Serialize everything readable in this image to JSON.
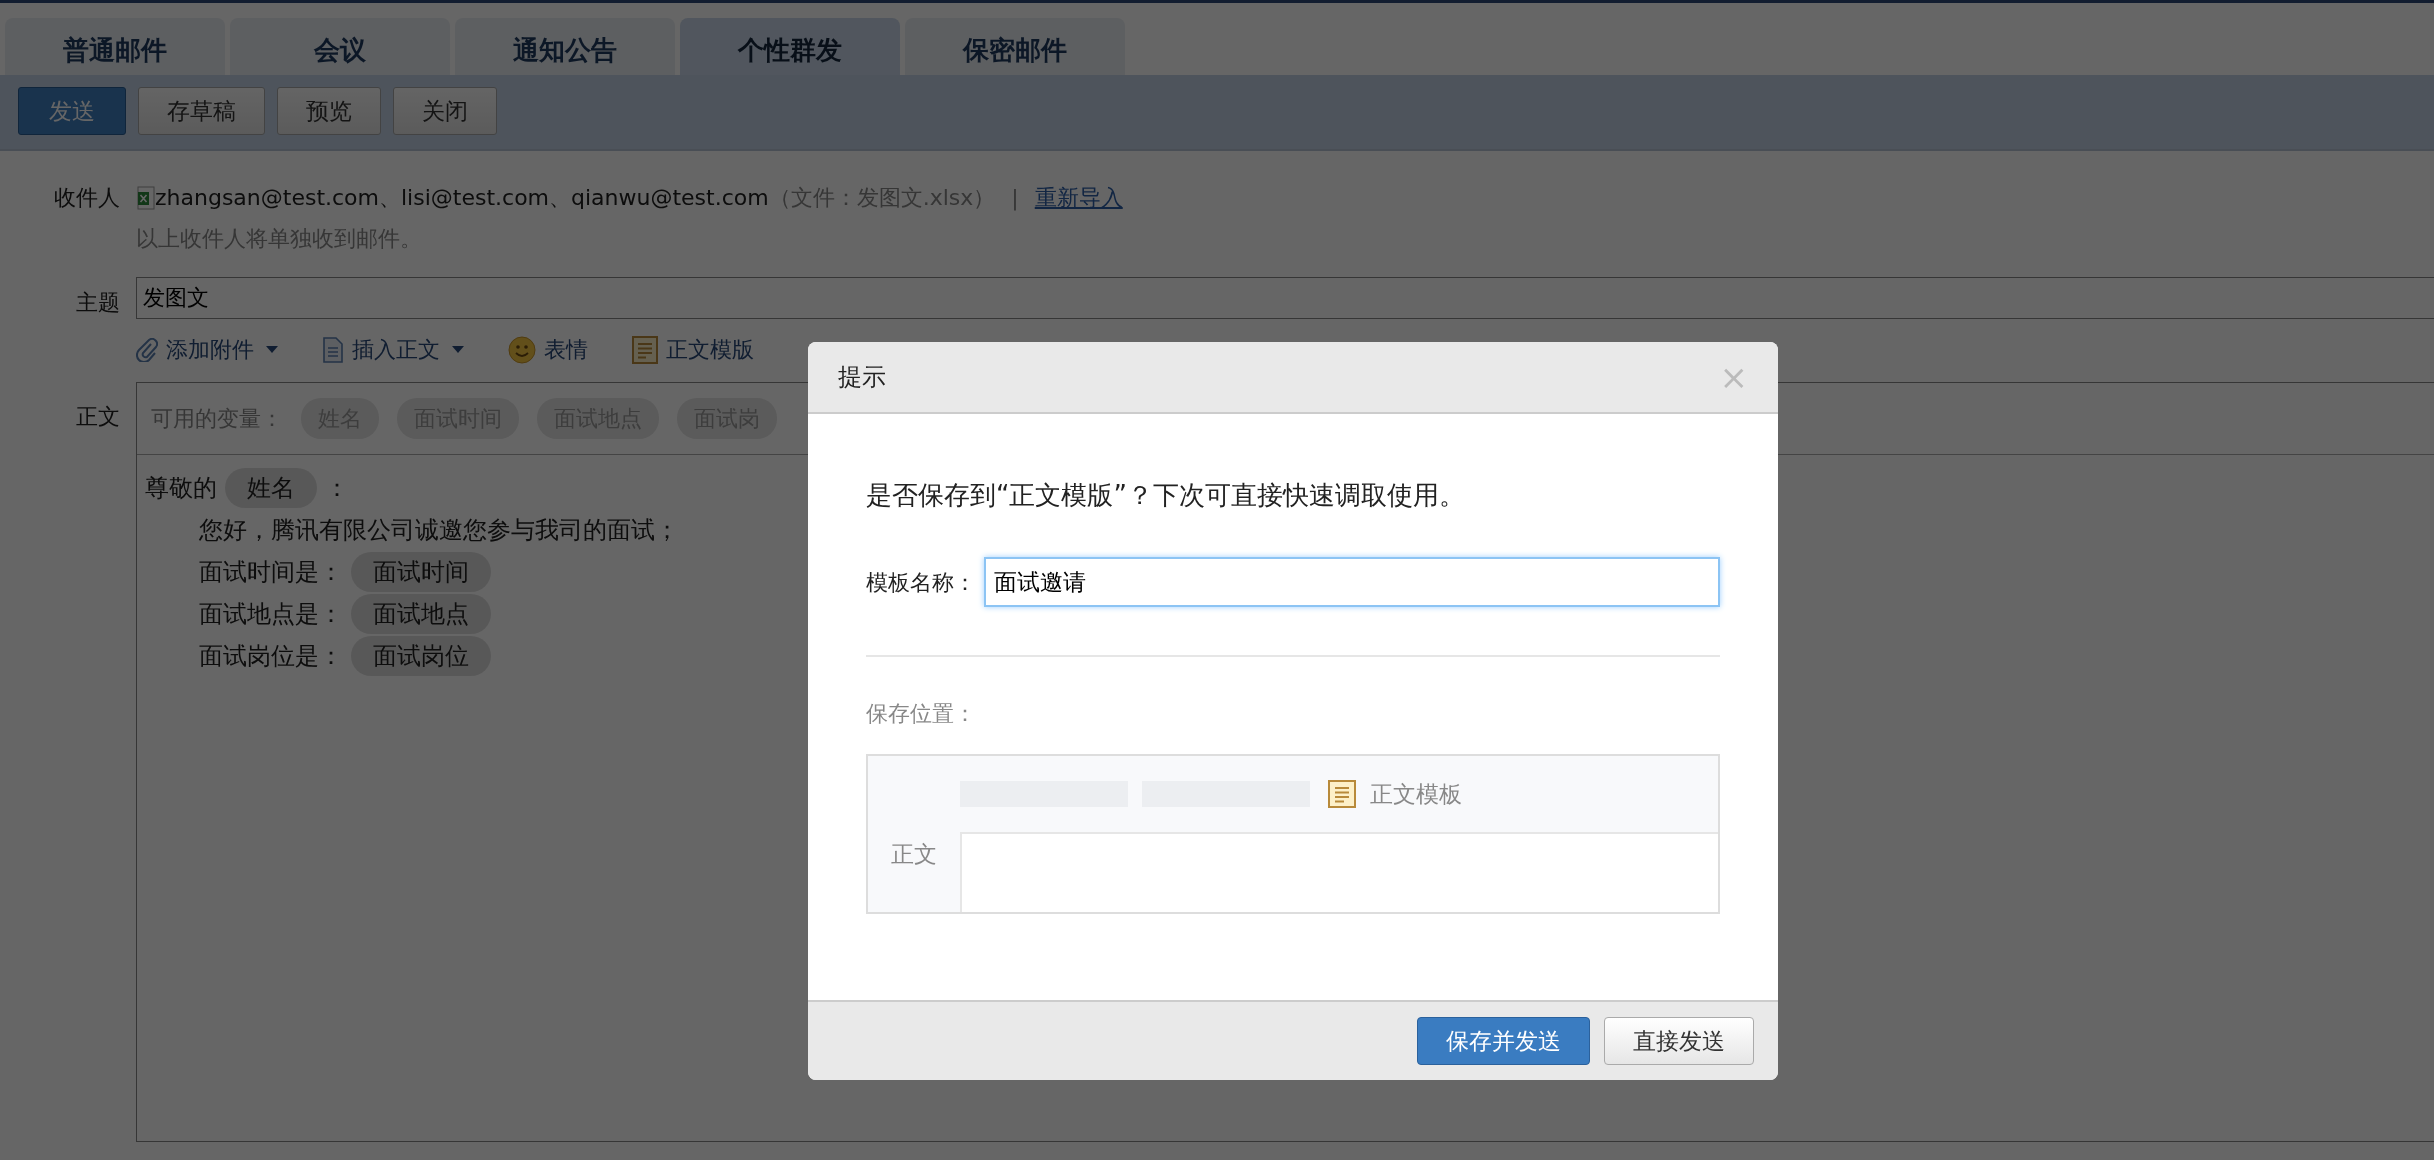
{
  "tabs": [
    {
      "label": "普通邮件",
      "selected": false
    },
    {
      "label": "会议",
      "selected": false
    },
    {
      "label": "通知公告",
      "selected": false
    },
    {
      "label": "个性群发",
      "selected": true
    },
    {
      "label": "保密邮件",
      "selected": false
    }
  ],
  "toolbar": [
    {
      "label": "发送",
      "kind": "primary"
    },
    {
      "label": "存草稿",
      "kind": "default"
    },
    {
      "label": "预览",
      "kind": "default"
    },
    {
      "label": "关闭",
      "kind": "default"
    }
  ],
  "recipients": {
    "label": "收件人",
    "addresses": "zhangsan@test.com、lisi@test.com、qianwu@test.com",
    "file_note": "（文件：发图文.xlsx）",
    "separator": "|",
    "reimport_link": "重新导入",
    "hint": "以上收件人将单独收到邮件。"
  },
  "subject": {
    "label": "主题",
    "value": "发图文"
  },
  "compose_tools": [
    {
      "label": "添加附件",
      "kind": "attach",
      "dropdown": true
    },
    {
      "label": "插入正文",
      "kind": "insert",
      "dropdown": true
    },
    {
      "label": "表情",
      "kind": "emoji",
      "dropdown": false
    },
    {
      "label": "正文模版",
      "kind": "template",
      "dropdown": false
    }
  ],
  "body": {
    "label": "正文",
    "variables_label": "可用的变量：",
    "variables": [
      "姓名",
      "面试时间",
      "面试地点",
      "面试岗"
    ],
    "lines": [
      {
        "indented": false,
        "segments": [
          {
            "kind": "text",
            "text": "尊敬的"
          },
          {
            "kind": "variable",
            "text": "姓名"
          },
          {
            "kind": "text",
            "text": "："
          }
        ]
      },
      {
        "indented": true,
        "segments": [
          {
            "kind": "text",
            "text": "您好，腾讯有限公司诚邀您参与我司的面试；"
          }
        ]
      },
      {
        "indented": true,
        "segments": [
          {
            "kind": "text",
            "text": "面试时间是："
          },
          {
            "kind": "variable",
            "text": "面试时间"
          }
        ]
      },
      {
        "indented": true,
        "segments": [
          {
            "kind": "text",
            "text": "面试地点是："
          },
          {
            "kind": "variable",
            "text": "面试地点"
          }
        ]
      },
      {
        "indented": true,
        "segments": [
          {
            "kind": "text",
            "text": "面试岗位是："
          },
          {
            "kind": "variable",
            "text": "面试岗位"
          }
        ]
      }
    ]
  },
  "dialog": {
    "title": "提示",
    "close": "×",
    "message": "是否保存到“正文模版”？下次可直接快速调取使用。",
    "name_label": "模板名称：",
    "name_value": "面试邀请",
    "location_label": "保存位置：",
    "preview": {
      "row_label": "正文",
      "template_label": "正文模板"
    },
    "buttons": [
      {
        "label": "保存并发送",
        "kind": "primary"
      },
      {
        "label": "直接发送",
        "kind": "default"
      }
    ]
  }
}
